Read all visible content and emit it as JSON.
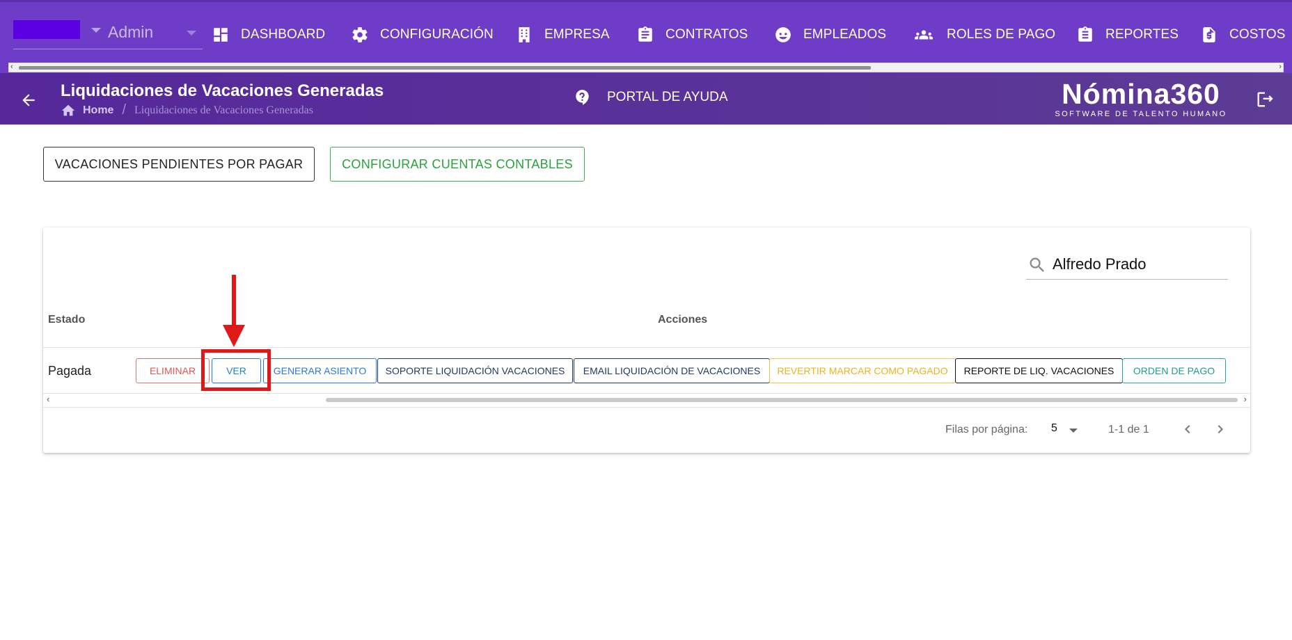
{
  "topnav": {
    "admin_label": "Admin",
    "items": [
      {
        "label": "DASHBOARD",
        "icon": "dashboard-icon"
      },
      {
        "label": "CONFIGURACIÓN",
        "icon": "gear-icon"
      },
      {
        "label": "EMPRESA",
        "icon": "building-icon"
      },
      {
        "label": "CONTRATOS",
        "icon": "clipboard-icon"
      },
      {
        "label": "EMPLEADOS",
        "icon": "face-icon"
      },
      {
        "label": "ROLES DE PAGO",
        "icon": "people-icon"
      },
      {
        "label": "REPORTES",
        "icon": "report-icon"
      },
      {
        "label": "COSTOS",
        "icon": "cost-file-icon"
      }
    ],
    "accent_color": "#6e3cc6"
  },
  "header": {
    "title": "Liquidaciones de Vacaciones Generadas",
    "breadcrumb_home": "Home",
    "breadcrumb_sep": "/",
    "breadcrumb_current": "Liquidaciones de Vacaciones Generadas",
    "help_label": "PORTAL DE AYUDA",
    "logo_main": "Nómina360",
    "logo_sub": "SOFTWARE DE TALENTO HUMANO"
  },
  "actions": {
    "pending_label": "VACACIONES PENDIENTES POR PAGAR",
    "cuentas_label": "CONFIGURAR CUENTAS CONTABLES"
  },
  "table": {
    "search_value": "Alfredo Prado",
    "columns": [
      "Estado",
      "Acciones"
    ],
    "rows": [
      {
        "estado": "Pagada",
        "actions": [
          "ELIMINAR",
          "VER",
          "GENERAR ASIENTO",
          "SOPORTE LIQUIDACIÓN VACACIONES",
          "EMAIL LIQUIDACIÓN DE VACACIONES",
          "REVERTIR MARCAR COMO PAGADO",
          "REPORTE DE LIQ. VACACIONES",
          "ORDEN DE PAGO"
        ]
      }
    ],
    "footer": {
      "rows_per_page_label": "Filas por página:",
      "rows_per_page_value": "5",
      "range": "1-1 de 1"
    }
  },
  "annotation": {
    "highlight_color": "#e01818",
    "highlight_target": "VER"
  }
}
